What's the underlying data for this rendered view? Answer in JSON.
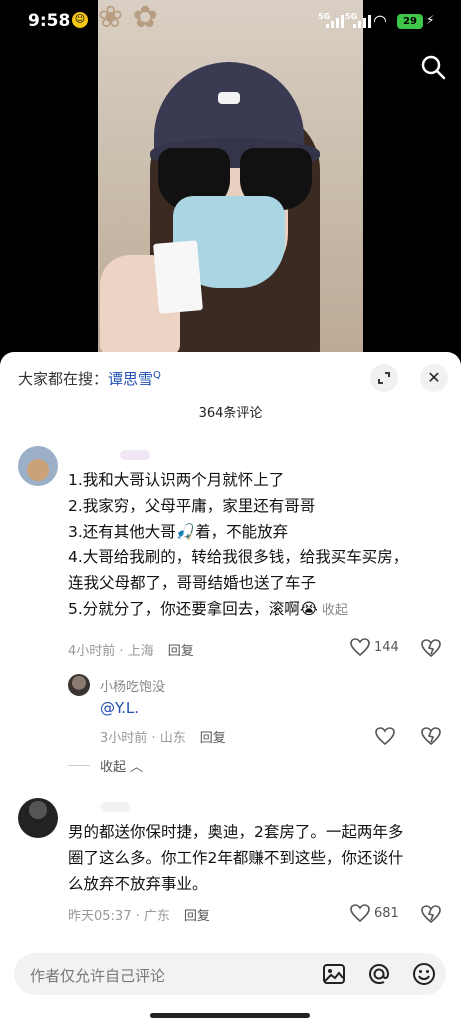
{
  "status_bar": {
    "time": "9:58",
    "network_tag_1": "5G",
    "network_tag_2": "5G",
    "battery": "29"
  },
  "hot_search": {
    "prefix": "大家都在搜：",
    "term": "谭思雪"
  },
  "comments_count": "364条评论",
  "comments": [
    {
      "lines": [
        "1.我和大哥认识两个月就怀上了",
        "2.我家穷，父母平庸，家里还有哥哥",
        "3.还有其他大哥🎣着，不能放弃",
        "4.大哥给我刷的，转给我很多钱，给我买车买房，",
        "连我父母都了，哥哥结婚也送了车子",
        "5.分就分了，你还要拿回去，滚啊😭"
      ],
      "collapse": "收起",
      "time": "4小时前",
      "location": "上海",
      "reply": "回复",
      "likes": "144"
    },
    {
      "lines": [
        "男的都送你保时捷，奥迪，2套房了。一起两年多",
        "圈了这么多。你工作2年都赚不到这些，你还谈什",
        "么放弃不放弃事业。"
      ],
      "time": "昨天05:37",
      "location": "广东",
      "reply": "回复",
      "likes": "681"
    }
  ],
  "reply": {
    "user": "小杨吃饱没",
    "text": "@Y.L.",
    "time": "3小时前",
    "location": "山东",
    "reply": "回复"
  },
  "fold_label": "收起",
  "input": {
    "placeholder": "作者仅允许自己评论"
  }
}
